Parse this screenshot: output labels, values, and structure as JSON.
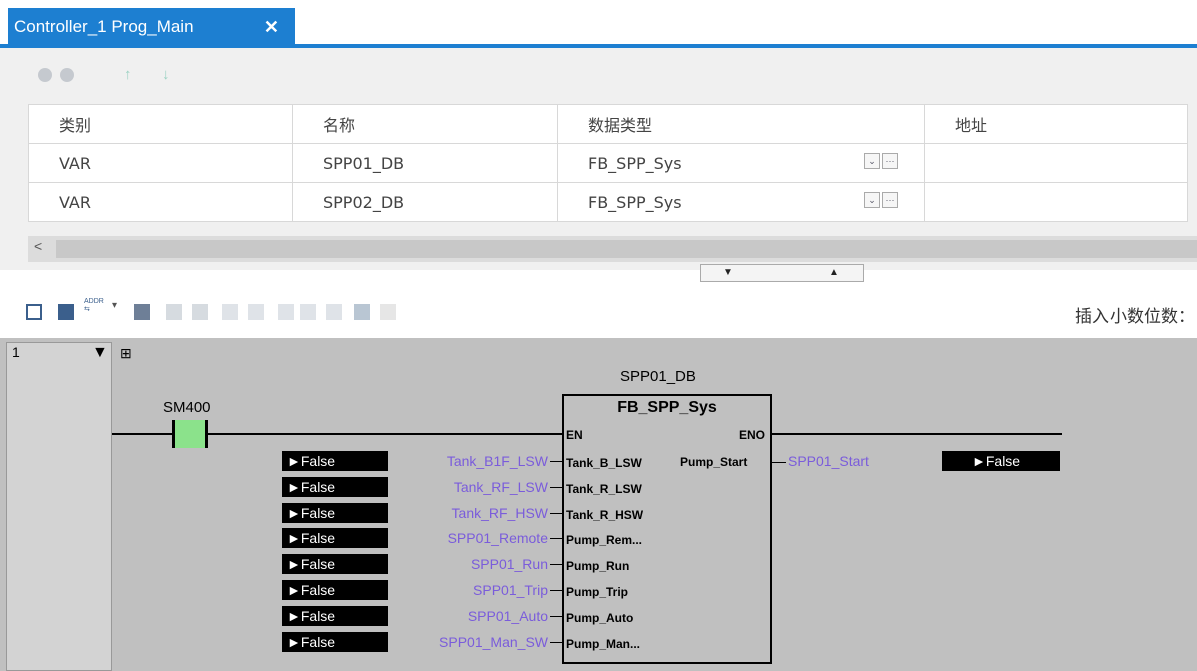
{
  "tab": {
    "title": "Controller_1 Prog_Main",
    "close": "✕"
  },
  "var_table": {
    "columns": [
      "类别",
      "名称",
      "数据类型",
      "地址"
    ],
    "rows": [
      {
        "category": "VAR",
        "name": "SPP01_DB",
        "type": "FB_SPP_Sys",
        "address": ""
      },
      {
        "category": "VAR",
        "name": "SPP02_DB",
        "type": "FB_SPP_Sys",
        "address": ""
      }
    ],
    "dropdown_glyph": "⌄",
    "more_glyph": "···"
  },
  "scroll": {
    "left_arrow": "<"
  },
  "splitter": {
    "down": "▼",
    "up": "▲"
  },
  "ladder_toolbar": {
    "insert_label": "插入",
    "decimal_label": "小数位数：",
    "addr_label": "ADDR"
  },
  "ladder": {
    "rung_number": "1",
    "rung_marker": "▼",
    "expand_glyph": "⊞",
    "contact": "SM400",
    "fb_instance": "SPP01_DB",
    "fb_type": "FB_SPP_Sys",
    "en": "EN",
    "eno": "ENO",
    "output_pin": "Pump_Start",
    "output_var": "SPP01_Start",
    "output_value": "►False",
    "inputs": [
      {
        "var": "Tank_B1F_LSW",
        "pin": "Tank_B_LSW",
        "value": "►False"
      },
      {
        "var": "Tank_RF_LSW",
        "pin": "Tank_R_LSW",
        "value": "►False"
      },
      {
        "var": "Tank_RF_HSW",
        "pin": "Tank_R_HSW",
        "value": "►False"
      },
      {
        "var": "SPP01_Remote",
        "pin": "Pump_Rem...",
        "value": "►False"
      },
      {
        "var": "SPP01_Run",
        "pin": "Pump_Run",
        "value": "►False"
      },
      {
        "var": "SPP01_Trip",
        "pin": "Pump_Trip",
        "value": "►False"
      },
      {
        "var": "SPP01_Auto",
        "pin": "Pump_Auto",
        "value": "►False"
      },
      {
        "var": "SPP01_Man_SW",
        "pin": "Pump_Man...",
        "value": "►False"
      }
    ]
  }
}
